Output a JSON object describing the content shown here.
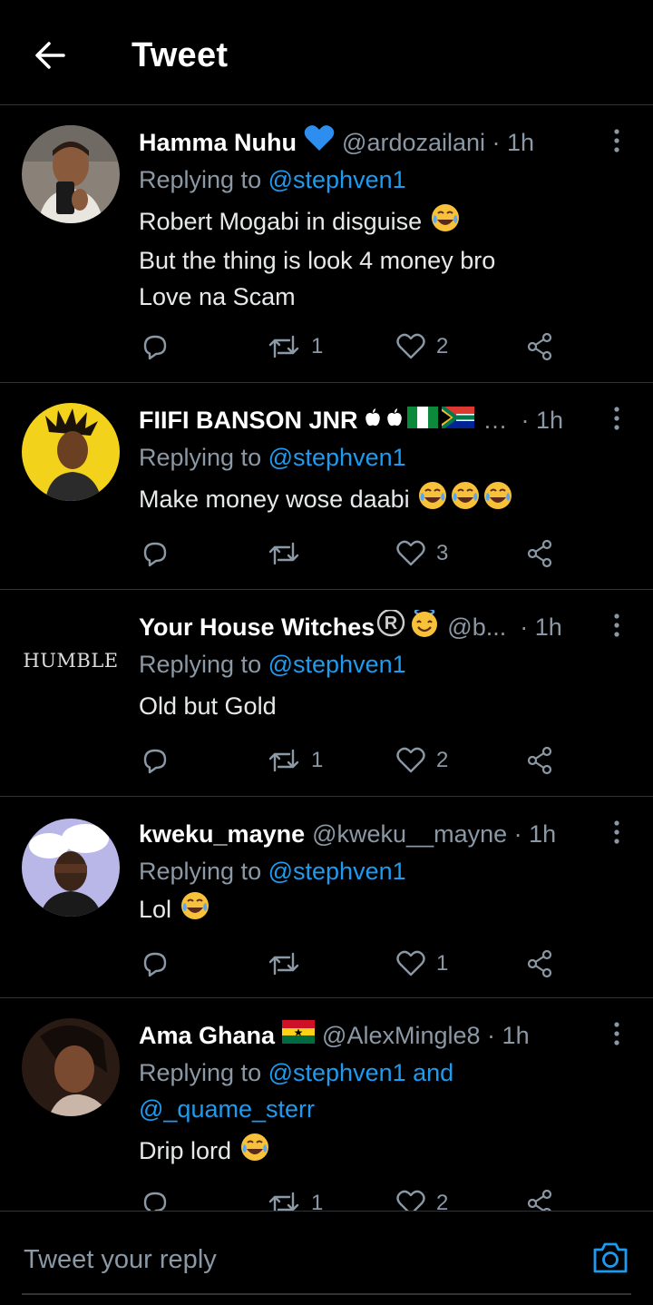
{
  "header": {
    "title": "Tweet"
  },
  "replying_label": "Replying to",
  "tweets": [
    {
      "name": "Hamma Nuhu",
      "handle": "@ardozailani",
      "time": "1h",
      "reply_to": "@stephven1",
      "lines": [
        "Robert Mogabi in disguise",
        "But the thing is look 4 money bro",
        "Love na Scam"
      ],
      "retweets": "1",
      "likes": "2"
    },
    {
      "name": "FIIFI BANSON JNR",
      "handle": "…",
      "time": "1h",
      "reply_to": "@stephven1",
      "lines": [
        "Make money wose daabi"
      ],
      "retweets": "",
      "likes": "3"
    },
    {
      "name": "Your House Witches",
      "handle": "@b...",
      "time": "1h",
      "reply_to": "@stephven1",
      "avatar_text": "HUMBLE",
      "lines": [
        "Old but Gold"
      ],
      "retweets": "1",
      "likes": "2"
    },
    {
      "name": "kweku_mayne",
      "handle": "@kweku__mayne",
      "time": "1h",
      "reply_to": "@stephven1",
      "lines": [
        "Lol"
      ],
      "retweets": "",
      "likes": "1"
    },
    {
      "name": "Ama Ghana",
      "handle": "@AlexMingle8",
      "time": "1h",
      "reply_to": "@stephven1",
      "reply_and": "and",
      "reply_to_2": "@_quame_sterr",
      "lines": [
        "Drip lord"
      ],
      "retweets": "1",
      "likes": "2"
    }
  ],
  "composer": {
    "placeholder": "Tweet your reply"
  },
  "colors": {
    "accent": "#1d9bf0",
    "muted": "#8b98a5",
    "divider": "#2f3336",
    "background": "#000000"
  }
}
